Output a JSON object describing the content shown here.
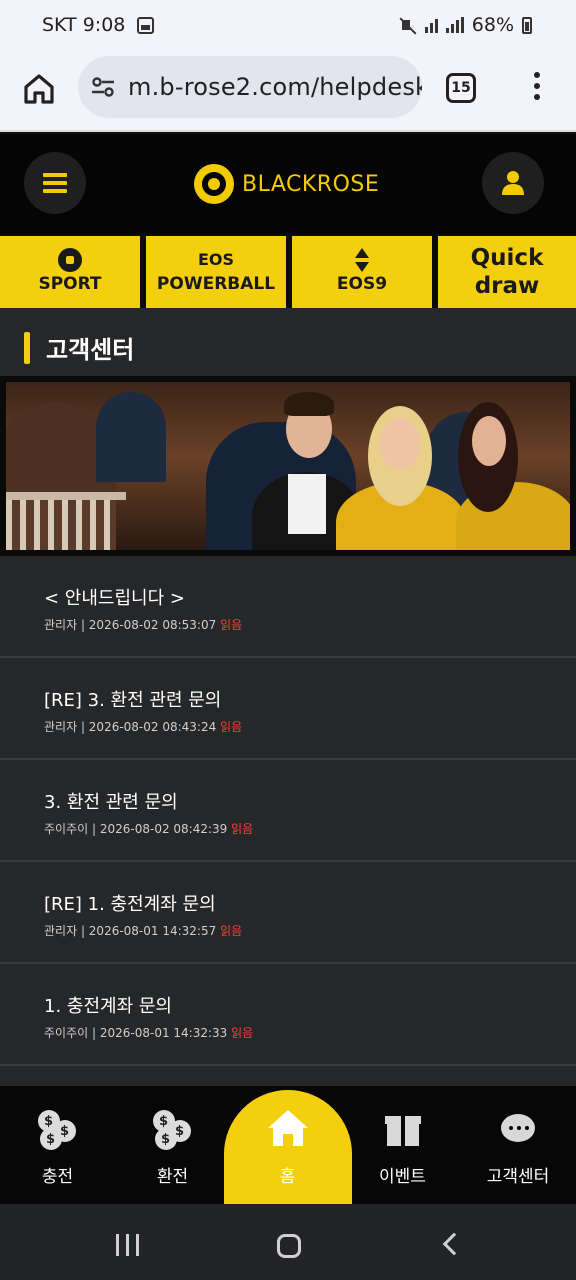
{
  "status_bar": {
    "carrier": "SKT",
    "time": "9:08",
    "battery": "68%"
  },
  "browser": {
    "url": "m.b-rose2.com/helpdesk",
    "tab_count": "15"
  },
  "header": {
    "brand": "BLACKROSE"
  },
  "quick_nav": [
    {
      "line1": "",
      "line2": "SPORT",
      "icon": "soccer-ball-icon"
    },
    {
      "line1": "EOS",
      "line2": "POWERBALL",
      "icon": ""
    },
    {
      "line1": "",
      "line2": "EOS9",
      "icon": "updown-arrows-icon"
    },
    {
      "line1": "Quick",
      "line2": "draw",
      "icon": ""
    }
  ],
  "section": {
    "title": "고객센터"
  },
  "posts": [
    {
      "title": "< 안내드립니다 >",
      "author": "관리자",
      "datetime": "2026-08-02 08:53:07",
      "status": "읽음"
    },
    {
      "title": "[RE] 3. 환전 관련 문의",
      "author": "관리자",
      "datetime": "2026-08-02 08:43:24",
      "status": "읽음"
    },
    {
      "title": "3. 환전 관련 문의",
      "author": "주이주이",
      "datetime": "2026-08-02 08:42:39",
      "status": "읽음"
    },
    {
      "title": "[RE] 1. 충전계좌 문의",
      "author": "관리자",
      "datetime": "2026-08-01 14:32:57",
      "status": "읽음"
    },
    {
      "title": "1. 충전계좌 문의",
      "author": "주이주이",
      "datetime": "2026-08-01 14:32:33",
      "status": "읽음"
    }
  ],
  "bottom_tabs": [
    {
      "label": "충전",
      "icon": "coins-icon"
    },
    {
      "label": "환전",
      "icon": "coins-icon"
    },
    {
      "label": "홈",
      "icon": "house-icon"
    },
    {
      "label": "이벤트",
      "icon": "gift-icon"
    },
    {
      "label": "고객센터",
      "icon": "support-chat-icon"
    }
  ],
  "colors": {
    "accent": "#f4cf0e",
    "read_status": "#ff3b3b",
    "panel": "#262729"
  }
}
